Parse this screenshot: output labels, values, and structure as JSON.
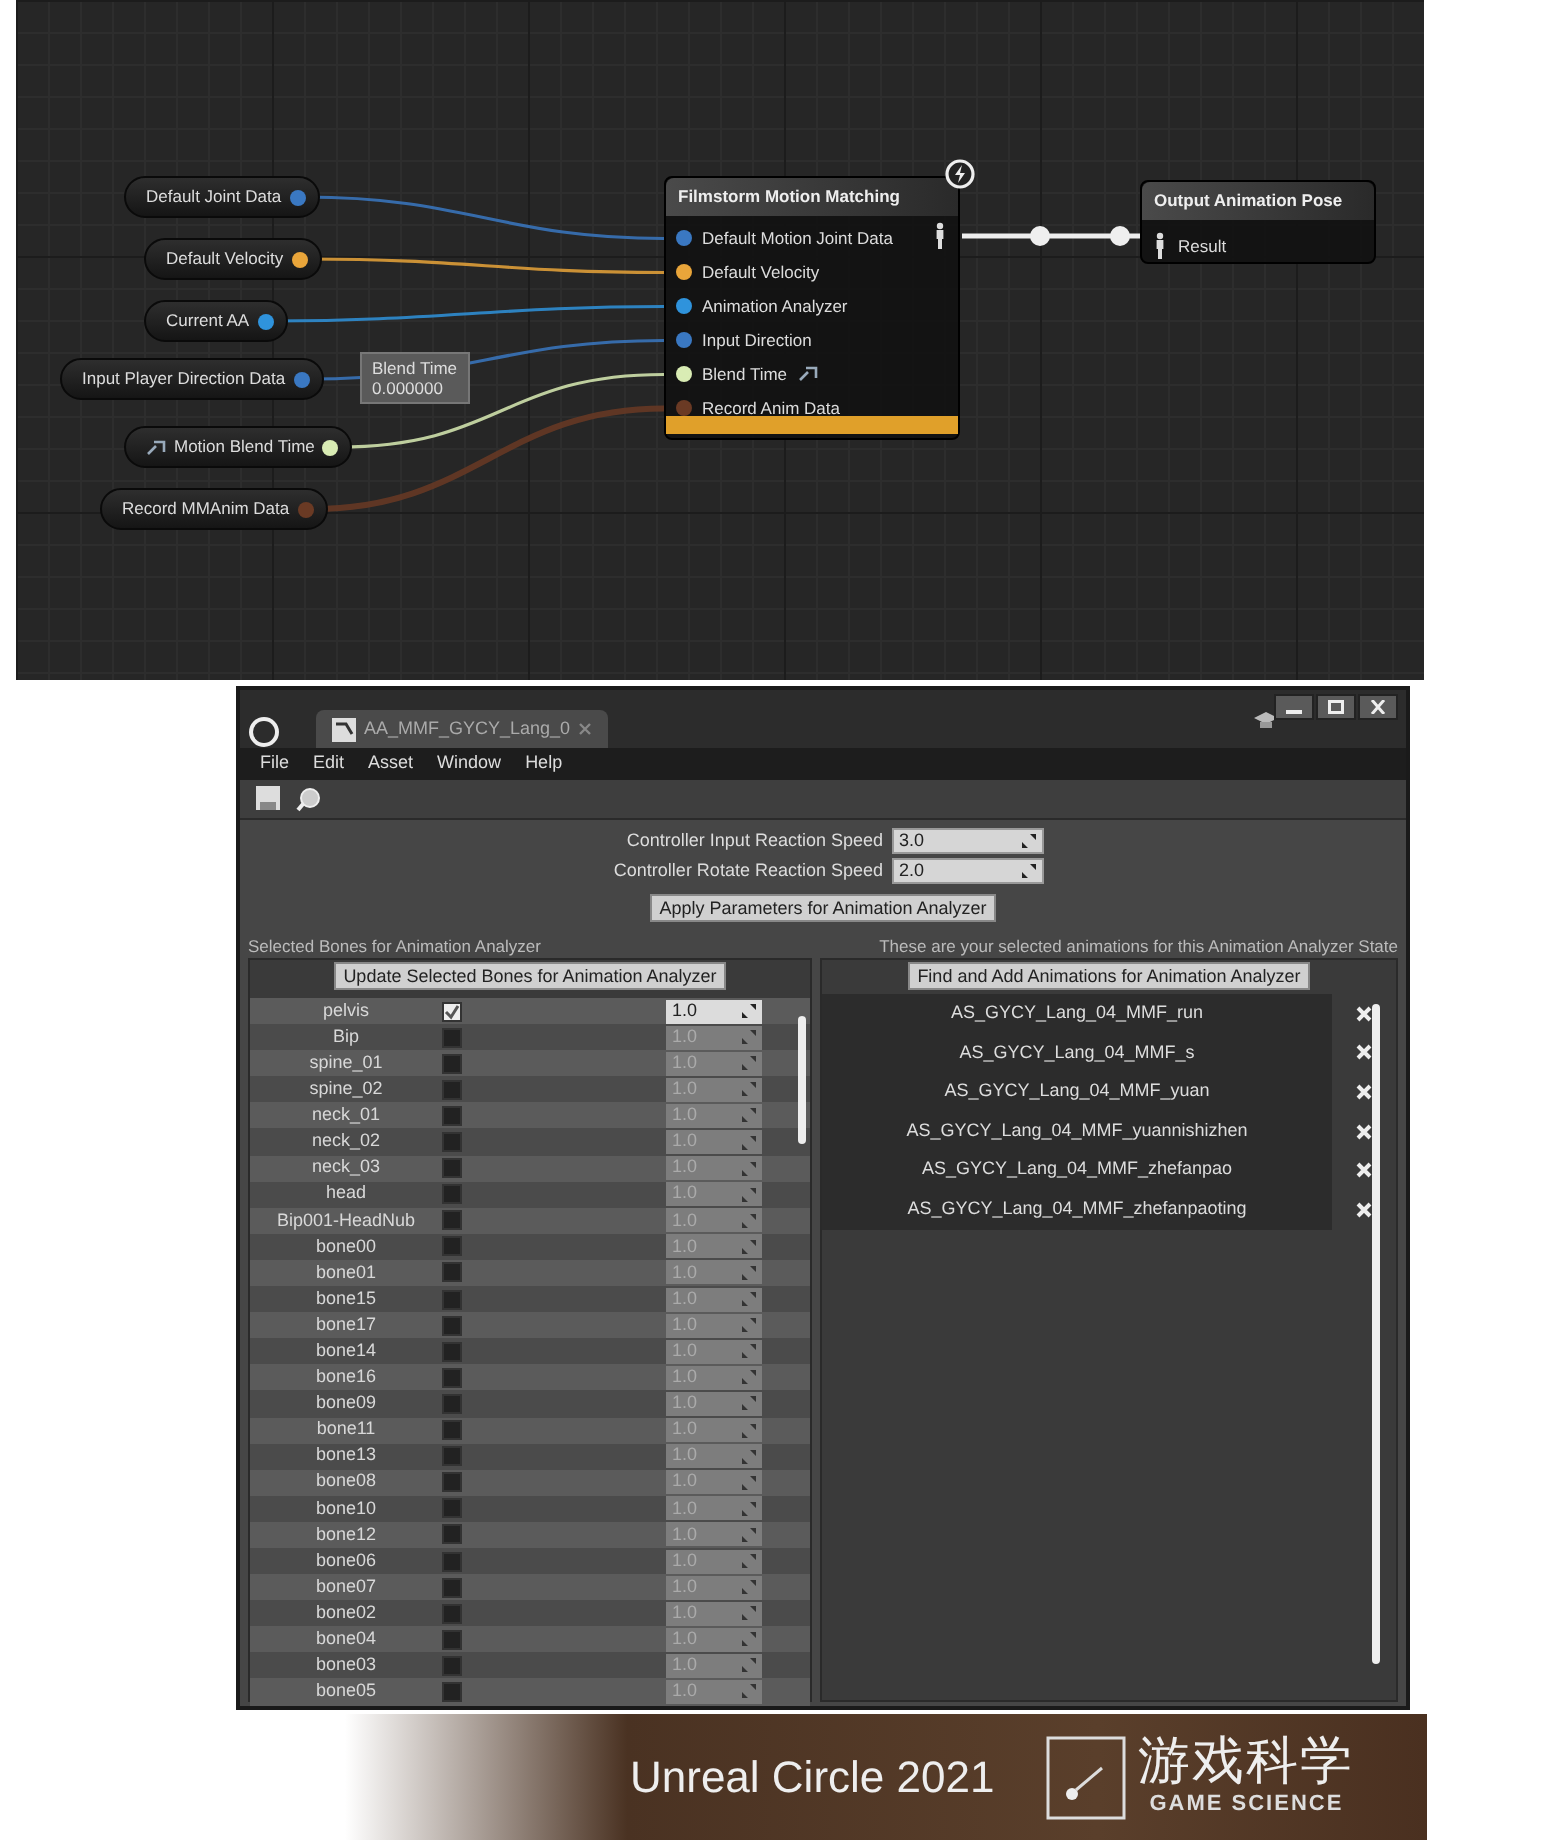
{
  "graph": {
    "variables": [
      {
        "label": "Default Joint Data",
        "color": "#3a78c2"
      },
      {
        "label": "Default Velocity",
        "color": "#e9a53a"
      },
      {
        "label": "Current AA",
        "color": "#2f93dc"
      },
      {
        "label": "Input Player Direction Data",
        "color": "#3a78c2"
      },
      {
        "label": "Motion Blend Time",
        "color": "#d9ecb4"
      },
      {
        "label": "Record MMAnim Data",
        "color": "#6a3a24"
      }
    ],
    "tooltip": {
      "label": "Blend Time",
      "value": "0.000000"
    },
    "main_node": {
      "title": "Filmstorm Motion Matching",
      "pins": [
        {
          "label": "Default Motion Joint Data",
          "color": "#3a78c2"
        },
        {
          "label": "Default Velocity",
          "color": "#e9a53a"
        },
        {
          "label": "Animation Analyzer",
          "color": "#2f93dc"
        },
        {
          "label": "Input Direction",
          "color": "#3a78c2"
        },
        {
          "label": "Blend Time",
          "color": "#d9ecb4"
        },
        {
          "label": "Record Anim Data",
          "color": "#6a3a24"
        }
      ]
    },
    "output_node": {
      "title": "Output Animation Pose",
      "pin": "Result"
    }
  },
  "editor": {
    "tab": {
      "title": "AA_MMF_GYCY_Lang_0"
    },
    "menu": [
      "File",
      "Edit",
      "Asset",
      "Window",
      "Help"
    ],
    "params": [
      {
        "label": "Controller Input Reaction Speed",
        "value": "3.0"
      },
      {
        "label": "Controller Rotate Reaction Speed",
        "value": "2.0"
      }
    ],
    "apply_button": "Apply Parameters for Animation Analyzer",
    "bones_panel": {
      "title": "Selected Bones for Animation Analyzer",
      "button": "Update Selected Bones for Animation Analyzer",
      "bones": [
        {
          "name": "pelvis",
          "checked": true,
          "weight": "1.0"
        },
        {
          "name": "Bip",
          "checked": false,
          "weight": "1.0"
        },
        {
          "name": "spine_01",
          "checked": false,
          "weight": "1.0"
        },
        {
          "name": "spine_02",
          "checked": false,
          "weight": "1.0"
        },
        {
          "name": "neck_01",
          "checked": false,
          "weight": "1.0"
        },
        {
          "name": "neck_02",
          "checked": false,
          "weight": "1.0"
        },
        {
          "name": "neck_03",
          "checked": false,
          "weight": "1.0"
        },
        {
          "name": "head",
          "checked": false,
          "weight": "1.0"
        },
        {
          "name": "Bip001-HeadNub",
          "checked": false,
          "weight": "1.0"
        },
        {
          "name": "bone00",
          "checked": false,
          "weight": "1.0"
        },
        {
          "name": "bone01",
          "checked": false,
          "weight": "1.0"
        },
        {
          "name": "bone15",
          "checked": false,
          "weight": "1.0"
        },
        {
          "name": "bone17",
          "checked": false,
          "weight": "1.0"
        },
        {
          "name": "bone14",
          "checked": false,
          "weight": "1.0"
        },
        {
          "name": "bone16",
          "checked": false,
          "weight": "1.0"
        },
        {
          "name": "bone09",
          "checked": false,
          "weight": "1.0"
        },
        {
          "name": "bone11",
          "checked": false,
          "weight": "1.0"
        },
        {
          "name": "bone13",
          "checked": false,
          "weight": "1.0"
        },
        {
          "name": "bone08",
          "checked": false,
          "weight": "1.0"
        },
        {
          "name": "bone10",
          "checked": false,
          "weight": "1.0"
        },
        {
          "name": "bone12",
          "checked": false,
          "weight": "1.0"
        },
        {
          "name": "bone06",
          "checked": false,
          "weight": "1.0"
        },
        {
          "name": "bone07",
          "checked": false,
          "weight": "1.0"
        },
        {
          "name": "bone02",
          "checked": false,
          "weight": "1.0"
        },
        {
          "name": "bone04",
          "checked": false,
          "weight": "1.0"
        },
        {
          "name": "bone03",
          "checked": false,
          "weight": "1.0"
        },
        {
          "name": "bone05",
          "checked": false,
          "weight": "1.0"
        }
      ]
    },
    "animations_panel": {
      "title": "These are your selected animations for this Animation Analyzer State",
      "button": "Find and Add Animations for Animation Analyzer",
      "animations": [
        "AS_GYCY_Lang_04_MMF_run",
        "AS_GYCY_Lang_04_MMF_s",
        "AS_GYCY_Lang_04_MMF_yuan",
        "AS_GYCY_Lang_04_MMF_yuannishizhen",
        "AS_GYCY_Lang_04_MMF_zhefanpao",
        "AS_GYCY_Lang_04_MMF_zhefanpaoting"
      ]
    }
  },
  "footer": {
    "event": "Unreal Circle 2021",
    "brand_cn": "游戏科学",
    "brand_en": "GAME SCIENCE"
  }
}
